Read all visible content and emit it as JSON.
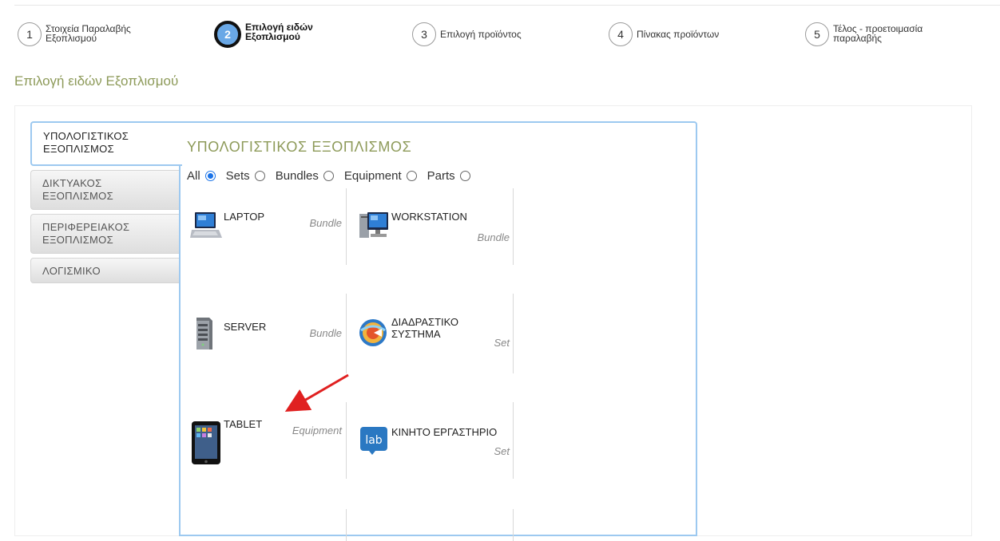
{
  "steps": [
    {
      "num": "1",
      "label_line1": "Στοιχεία Παραλαβής",
      "label_line2": "Εξοπλισμού"
    },
    {
      "num": "2",
      "label_line1": "Επιλογή ειδών",
      "label_line2": "Εξοπλισμού"
    },
    {
      "num": "3",
      "label_line1": "Επιλογή προϊόντος"
    },
    {
      "num": "4",
      "label_line1": "Πίνακας προϊόντων"
    },
    {
      "num": "5",
      "label_line1": "Τέλος - προετοιμασία",
      "label_line2": "παραλαβής"
    }
  ],
  "active_step": 2,
  "page_title": "Επιλογή ειδών Εξοπλισμού",
  "tabs": [
    {
      "line1": "ΥΠΟΛΟΓΙΣΤΙΚΟΣ",
      "line2": "ΕΞΟΠΛΙΣΜΟΣ"
    },
    {
      "line1": "ΔΙΚΤΥΑΚΟΣ",
      "line2": "ΕΞΟΠΛΙΣΜΟΣ"
    },
    {
      "line1": "ΠΕΡΙΦΕΡΕΙΑΚΟΣ",
      "line2": "ΕΞΟΠΛΙΣΜΟΣ"
    },
    {
      "line1": "ΛΟΓΙΣΜΙΚΟ"
    }
  ],
  "content_title": "ΥΠΟΛΟΓΙΣΤΙΚΟΣ ΕΞΟΠΛΙΣΜΟΣ",
  "filters": [
    {
      "label": "All",
      "checked": true
    },
    {
      "label": "Sets",
      "checked": false
    },
    {
      "label": "Bundles",
      "checked": false
    },
    {
      "label": "Equipment",
      "checked": false
    },
    {
      "label": "Parts",
      "checked": false
    }
  ],
  "products": [
    {
      "name_line1": "LAPTOP",
      "type": "Bundle",
      "icon": "laptop-icon"
    },
    {
      "name_line1": "WORKSTATION",
      "type": "Bundle",
      "icon": "workstation-icon"
    },
    {
      "name_line1": "SERVER",
      "type": "Bundle",
      "icon": "server-icon"
    },
    {
      "name_line1": "ΔΙΑΔΡΑΣΤΙΚΟ",
      "name_line2": "ΣΥΣΤΗΜΑ",
      "type": "Set",
      "icon": "interactive-system-icon"
    },
    {
      "name_line1": "TABLET",
      "type": "Equipment",
      "icon": "tablet-icon"
    },
    {
      "name_line1": "ΚΙΝΗΤΟ ΕΡΓΑΣΤΗΡΙΟ",
      "type": "Set",
      "icon": "mobile-lab-icon"
    }
  ],
  "colors": {
    "accent": "#8d9a59",
    "tab_border": "#9dc9f0",
    "active_step": "#6aa8e6",
    "arrow": "#e02020"
  },
  "lab_icon_text": "lab"
}
